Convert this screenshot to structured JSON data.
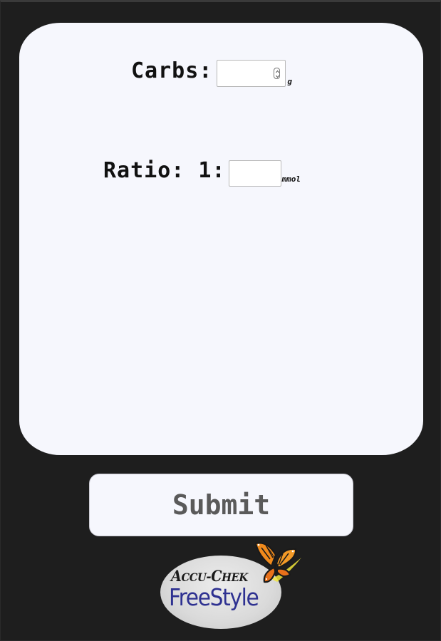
{
  "form": {
    "carbs": {
      "label": "Carbs:",
      "value": "",
      "unit": "g"
    },
    "ratio": {
      "label": "Ratio: 1:",
      "value": "",
      "unit": "mmol"
    }
  },
  "submit_label": "Submit",
  "logo": {
    "brand_top": "ACCU-CHEK",
    "brand_main": "FreeStyle",
    "icon": "butterfly-icon"
  },
  "colors": {
    "background": "#1e1e1e",
    "card": "#f6f7fd",
    "brand_blue": "#2e3191",
    "butterfly_orange": "#f08a1c"
  }
}
